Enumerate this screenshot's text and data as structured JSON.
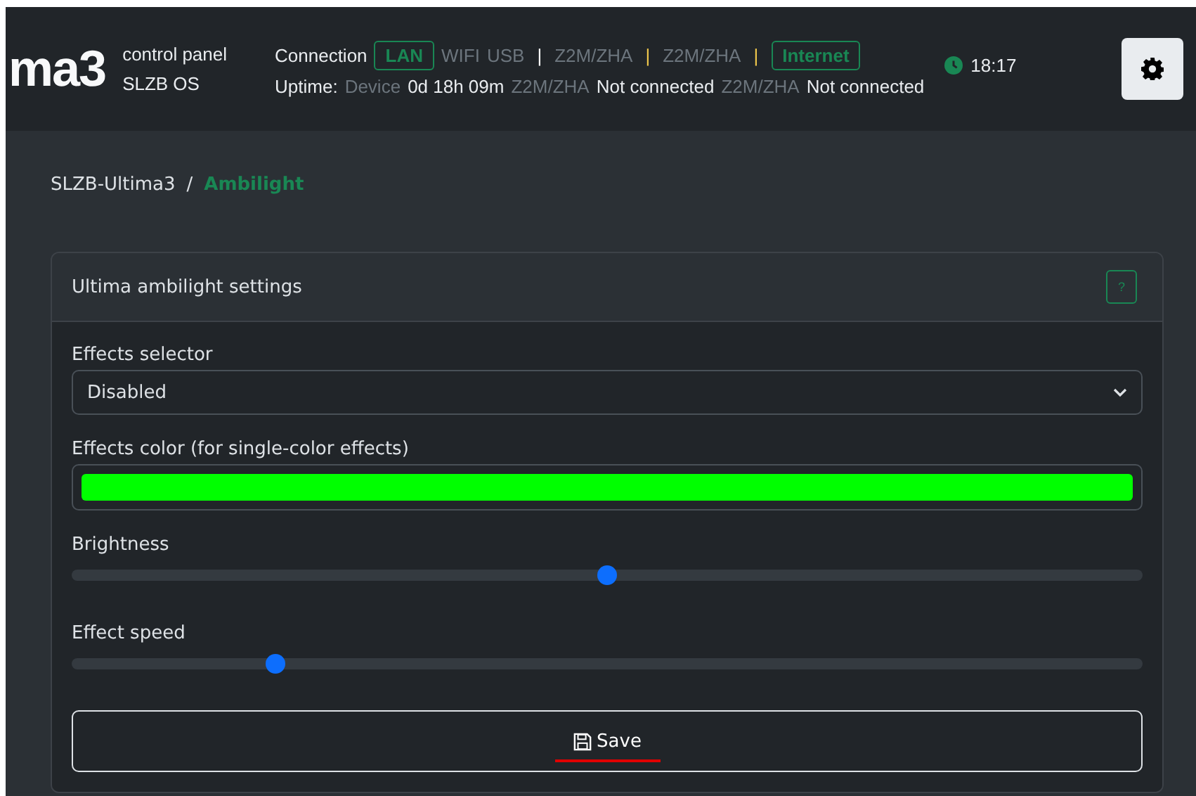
{
  "header": {
    "logo": "ma3",
    "subtitle": [
      "control panel",
      "SLZB OS"
    ],
    "connection": {
      "label": "Connection",
      "items": [
        {
          "kind": "badge",
          "text": "LAN"
        },
        {
          "kind": "plain",
          "text": "WIFI"
        },
        {
          "kind": "plain",
          "text": "USB"
        },
        {
          "kind": "separator",
          "text": "|",
          "color": "#ffffff"
        },
        {
          "kind": "plain",
          "text": "Z2M/ZHA"
        },
        {
          "kind": "separator",
          "text": "|",
          "color": "#f2c94c"
        },
        {
          "kind": "plain",
          "text": "Z2M/ZHA"
        },
        {
          "kind": "separator",
          "text": "|",
          "color": "#f2c94c"
        },
        {
          "kind": "badge",
          "text": "Internet"
        }
      ]
    },
    "uptime": {
      "label": "Uptime:",
      "items": [
        {
          "name": "Device",
          "value": "0d 18h 09m"
        },
        {
          "name": "Z2M/ZHA",
          "value": "Not connected"
        },
        {
          "name": "Z2M/ZHA",
          "value": "Not connected"
        }
      ]
    },
    "time": "18:17"
  },
  "breadcrumb": {
    "separator": "/",
    "items": [
      {
        "text": "SLZB-Ultima3",
        "selected": false
      },
      {
        "text": "Ambilight",
        "selected": true
      }
    ]
  },
  "card": {
    "title": "Ultima ambilight settings",
    "help": "?",
    "fields": [
      {
        "kind": "select",
        "label": "Effects selector",
        "value": "Disabled"
      },
      {
        "kind": "color",
        "label": "Effects color (for single-color effects)",
        "color": "#00ff00"
      },
      {
        "kind": "slider",
        "label": "Brightness",
        "level": 0.5
      },
      {
        "kind": "slider",
        "label": "Effect speed",
        "level": 0.19
      }
    ],
    "save": "Save"
  }
}
